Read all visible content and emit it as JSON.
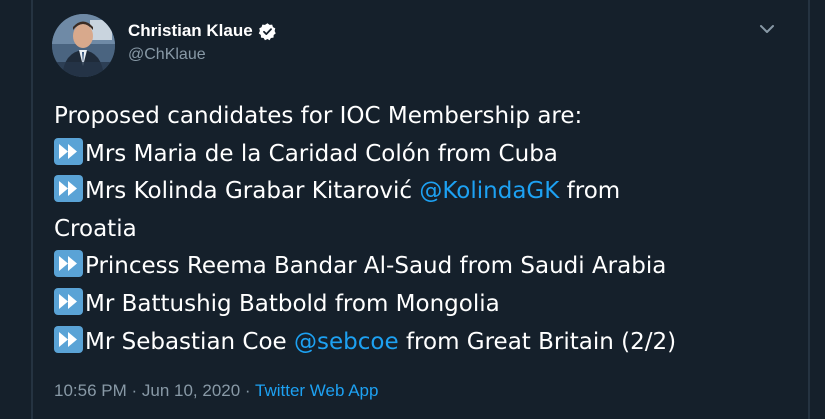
{
  "author": {
    "name": "Christian Klaue",
    "handle": "@ChKlaue"
  },
  "tweet": {
    "intro": "Proposed candidates for IOC Membership are:",
    "line1": "Mrs Maria de la Caridad Colón from Cuba",
    "line2_pre": "Mrs Kolinda Grabar Kitarović ",
    "line2_mention": "@KolindaGK",
    "line2_post": " from",
    "line2_cont": "Croatia",
    "line3": "Princess Reema Bandar Al-Saud from Saudi Arabia",
    "line4": "Mr Battushig Batbold from Mongolia",
    "line5_pre": "Mr Sebastian Coe ",
    "line5_mention": "@sebcoe",
    "line5_post": " from Great Britain (2/2)"
  },
  "meta": {
    "time": "10:56 PM",
    "sep1": " · ",
    "date": "Jun 10, 2020",
    "sep2": " · ",
    "source": "Twitter Web App"
  },
  "colors": {
    "background": "#15202b",
    "text": "#ffffff",
    "secondary": "#8899a6",
    "link": "#1da1f2",
    "emoji_blue": "#5aa3d6"
  },
  "icons": {
    "verified": "verified-badge-icon",
    "caret": "chevron-down-icon",
    "bullet": "fast-forward-emoji"
  }
}
